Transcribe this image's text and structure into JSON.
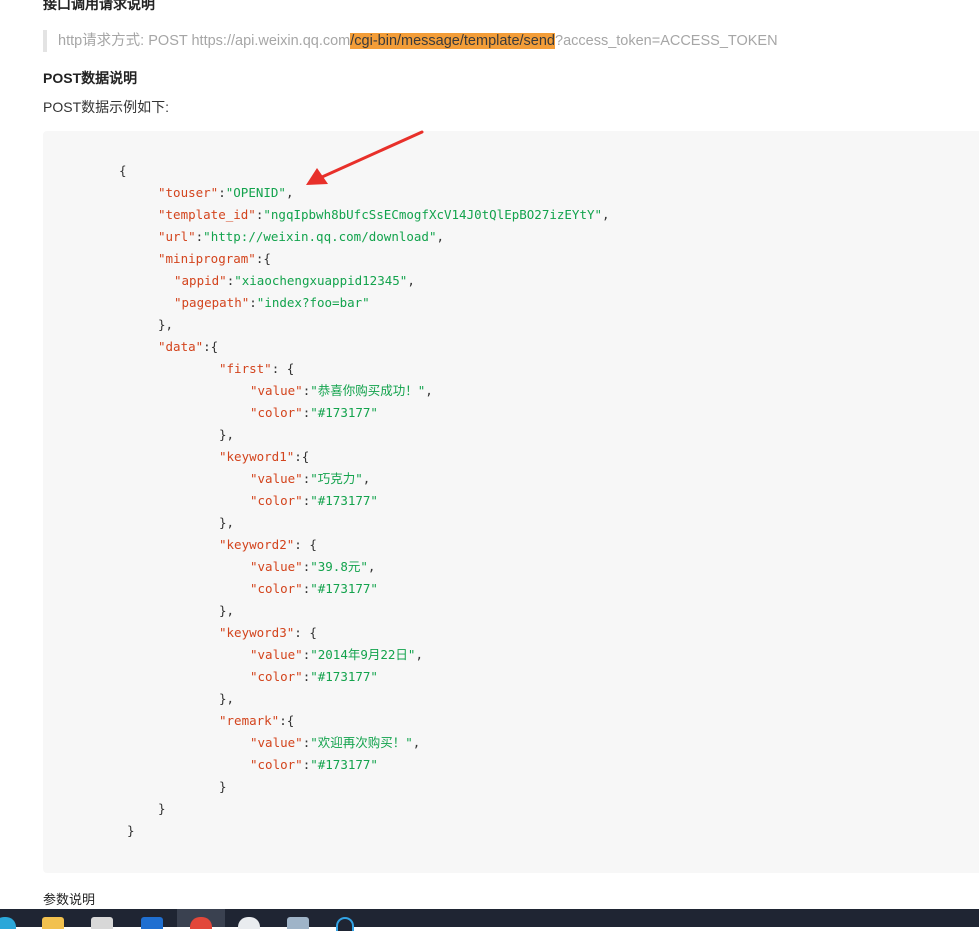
{
  "page": {
    "top_heading": "接口调用请求说明",
    "request": {
      "prefix": "http请求方式: POST https://api.weixin.qq.com",
      "highlight": "/cgi-bin/message/template/send",
      "suffix": "?access_token=ACCESS_TOKEN"
    },
    "post_heading": "POST数据说明",
    "post_desc": "POST数据示例如下:",
    "param_heading": "参数说明"
  },
  "code": {
    "lines": [
      {
        "indent": 0,
        "parts": [
          {
            "t": "p",
            "v": "{"
          }
        ]
      },
      {
        "indent": 1,
        "parts": [
          {
            "t": "k",
            "v": "\"touser\""
          },
          {
            "t": "p",
            "v": ":"
          },
          {
            "t": "s",
            "v": "\"OPENID\""
          },
          {
            "t": "p",
            "v": ","
          }
        ]
      },
      {
        "indent": 1,
        "parts": [
          {
            "t": "k",
            "v": "\"template_id\""
          },
          {
            "t": "p",
            "v": ":"
          },
          {
            "t": "s",
            "v": "\"ngqIpbwh8bUfcSsECmogfXcV14J0tQlEpBO27izEYtY\""
          },
          {
            "t": "p",
            "v": ","
          }
        ]
      },
      {
        "indent": 1,
        "parts": [
          {
            "t": "k",
            "v": "\"url\""
          },
          {
            "t": "p",
            "v": ":"
          },
          {
            "t": "s",
            "v": "\"http://weixin.qq.com/download\""
          },
          {
            "t": "p",
            "v": ","
          }
        ]
      },
      {
        "indent": 1,
        "parts": [
          {
            "t": "k",
            "v": "\"miniprogram\""
          },
          {
            "t": "p",
            "v": ":{"
          }
        ]
      },
      {
        "indent": 2,
        "parts": [
          {
            "t": "k",
            "v": "\"appid\""
          },
          {
            "t": "p",
            "v": ":"
          },
          {
            "t": "s",
            "v": "\"xiaochengxuappid12345\""
          },
          {
            "t": "p",
            "v": ","
          }
        ]
      },
      {
        "indent": 2,
        "parts": [
          {
            "t": "k",
            "v": "\"pagepath\""
          },
          {
            "t": "p",
            "v": ":"
          },
          {
            "t": "s",
            "v": "\"index?foo=bar\""
          }
        ]
      },
      {
        "indent": 1,
        "parts": [
          {
            "t": "p",
            "v": "},"
          }
        ]
      },
      {
        "indent": 1,
        "parts": [
          {
            "t": "k",
            "v": "\"data\""
          },
          {
            "t": "p",
            "v": ":{"
          }
        ]
      },
      {
        "indent": 3,
        "parts": [
          {
            "t": "k",
            "v": "\"first\""
          },
          {
            "t": "p",
            "v": ": {"
          }
        ]
      },
      {
        "indent": 4,
        "parts": [
          {
            "t": "k",
            "v": "\"value\""
          },
          {
            "t": "p",
            "v": ":"
          },
          {
            "t": "s",
            "v": "\"恭喜你购买成功！\""
          },
          {
            "t": "p",
            "v": ","
          }
        ]
      },
      {
        "indent": 4,
        "parts": [
          {
            "t": "k",
            "v": "\"color\""
          },
          {
            "t": "p",
            "v": ":"
          },
          {
            "t": "s",
            "v": "\"#173177\""
          }
        ]
      },
      {
        "indent": 3,
        "parts": [
          {
            "t": "p",
            "v": "},"
          }
        ]
      },
      {
        "indent": 3,
        "parts": [
          {
            "t": "k",
            "v": "\"keyword1\""
          },
          {
            "t": "p",
            "v": ":{"
          }
        ]
      },
      {
        "indent": 4,
        "parts": [
          {
            "t": "k",
            "v": "\"value\""
          },
          {
            "t": "p",
            "v": ":"
          },
          {
            "t": "s",
            "v": "\"巧克力\""
          },
          {
            "t": "p",
            "v": ","
          }
        ]
      },
      {
        "indent": 4,
        "parts": [
          {
            "t": "k",
            "v": "\"color\""
          },
          {
            "t": "p",
            "v": ":"
          },
          {
            "t": "s",
            "v": "\"#173177\""
          }
        ]
      },
      {
        "indent": 3,
        "parts": [
          {
            "t": "p",
            "v": "},"
          }
        ]
      },
      {
        "indent": 3,
        "parts": [
          {
            "t": "k",
            "v": "\"keyword2\""
          },
          {
            "t": "p",
            "v": ": {"
          }
        ]
      },
      {
        "indent": 4,
        "parts": [
          {
            "t": "k",
            "v": "\"value\""
          },
          {
            "t": "p",
            "v": ":"
          },
          {
            "t": "s",
            "v": "\"39.8元\""
          },
          {
            "t": "p",
            "v": ","
          }
        ]
      },
      {
        "indent": 4,
        "parts": [
          {
            "t": "k",
            "v": "\"color\""
          },
          {
            "t": "p",
            "v": ":"
          },
          {
            "t": "s",
            "v": "\"#173177\""
          }
        ]
      },
      {
        "indent": 3,
        "parts": [
          {
            "t": "p",
            "v": "},"
          }
        ]
      },
      {
        "indent": 3,
        "parts": [
          {
            "t": "k",
            "v": "\"keyword3\""
          },
          {
            "t": "p",
            "v": ": {"
          }
        ]
      },
      {
        "indent": 4,
        "parts": [
          {
            "t": "k",
            "v": "\"value\""
          },
          {
            "t": "p",
            "v": ":"
          },
          {
            "t": "s",
            "v": "\"2014年9月22日\""
          },
          {
            "t": "p",
            "v": ","
          }
        ]
      },
      {
        "indent": 4,
        "parts": [
          {
            "t": "k",
            "v": "\"color\""
          },
          {
            "t": "p",
            "v": ":"
          },
          {
            "t": "s",
            "v": "\"#173177\""
          }
        ]
      },
      {
        "indent": 3,
        "parts": [
          {
            "t": "p",
            "v": "},"
          }
        ]
      },
      {
        "indent": 3,
        "parts": [
          {
            "t": "k",
            "v": "\"remark\""
          },
          {
            "t": "p",
            "v": ":{"
          }
        ]
      },
      {
        "indent": 4,
        "parts": [
          {
            "t": "k",
            "v": "\"value\""
          },
          {
            "t": "p",
            "v": ":"
          },
          {
            "t": "s",
            "v": "\"欢迎再次购买！\""
          },
          {
            "t": "p",
            "v": ","
          }
        ]
      },
      {
        "indent": 4,
        "parts": [
          {
            "t": "k",
            "v": "\"color\""
          },
          {
            "t": "p",
            "v": ":"
          },
          {
            "t": "s",
            "v": "\"#173177\""
          }
        ]
      },
      {
        "indent": 3,
        "parts": [
          {
            "t": "p",
            "v": "}"
          }
        ]
      },
      {
        "indent": 1,
        "parts": [
          {
            "t": "p",
            "v": "}"
          }
        ]
      },
      {
        "indent": 5,
        "parts": [
          {
            "t": "p",
            "v": "}"
          }
        ]
      }
    ]
  },
  "colors": {
    "key": "#d3441d",
    "string": "#13a34d",
    "highlight": "#f39d38",
    "annotation_arrow": "#e8302a"
  },
  "taskbar": {
    "icons": [
      "edge-icon",
      "file-explorer-icon",
      "store-icon",
      "mail-icon",
      "chrome-icon",
      "wechat-icon",
      "notepad-icon",
      "search-icon"
    ]
  }
}
